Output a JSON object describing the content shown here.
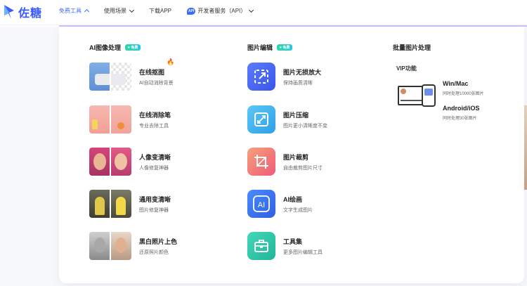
{
  "logo": {
    "text": "佐糖"
  },
  "nav": [
    {
      "label": "免费工具",
      "active": true,
      "chevron": "up"
    },
    {
      "label": "使用场景",
      "active": false,
      "chevron": "down"
    },
    {
      "label": "下载APP",
      "active": false,
      "chevron": ""
    },
    {
      "label": "开发者服务（API）",
      "active": false,
      "chevron": "down",
      "badge": "API"
    }
  ],
  "columns": {
    "ai": {
      "title": "AI图像处理",
      "tag": "♥ 免费"
    },
    "edit": {
      "title": "图片编辑",
      "tag": "♥ 免费"
    },
    "batch": {
      "title": "批量图片处理"
    }
  },
  "ai_items": [
    {
      "title": "在线抠图",
      "desc": "AI自动消除背景",
      "hot": true,
      "thumb": "sofa-thumb"
    },
    {
      "title": "在线消除笔",
      "desc": "专业去除工具",
      "hot": false,
      "thumb": "fruit-thumb"
    },
    {
      "title": "人像变清晰",
      "desc": "人像修复神器",
      "hot": false,
      "thumb": "portrait-thumb"
    },
    {
      "title": "通用变清晰",
      "desc": "图片修复神器",
      "hot": false,
      "thumb": "minion-thumb"
    },
    {
      "title": "黑白照片上色",
      "desc": "还原照片颜色",
      "hot": false,
      "thumb": "bw-photo-thumb"
    }
  ],
  "edit_items": [
    {
      "title": "图片无损放大",
      "desc": "保持画质清晰",
      "icon": "enlarge-icon",
      "color": "#4a6cf7"
    },
    {
      "title": "图片压缩",
      "desc": "图片更小清晰度不变",
      "icon": "compress-icon",
      "color": "#3bb3f0"
    },
    {
      "title": "图片裁剪",
      "desc": "自由裁剪图片尺寸",
      "icon": "crop-icon",
      "color": "#f26a7a"
    },
    {
      "title": "AI绘画",
      "desc": "文字生成图片",
      "icon": "ai-paint-icon",
      "color": "#3a7bf5"
    },
    {
      "title": "工具集",
      "desc": "更多图片编辑工具",
      "icon": "toolbox-icon",
      "color": "#2fc6a8"
    }
  ],
  "batch": {
    "vip_label": "VIP功能",
    "platforms": [
      {
        "name": "Win/Mac",
        "desc": "同时处理10000张图片"
      },
      {
        "name": "Android/iOS",
        "desc": "同时处理30张图片"
      }
    ]
  }
}
